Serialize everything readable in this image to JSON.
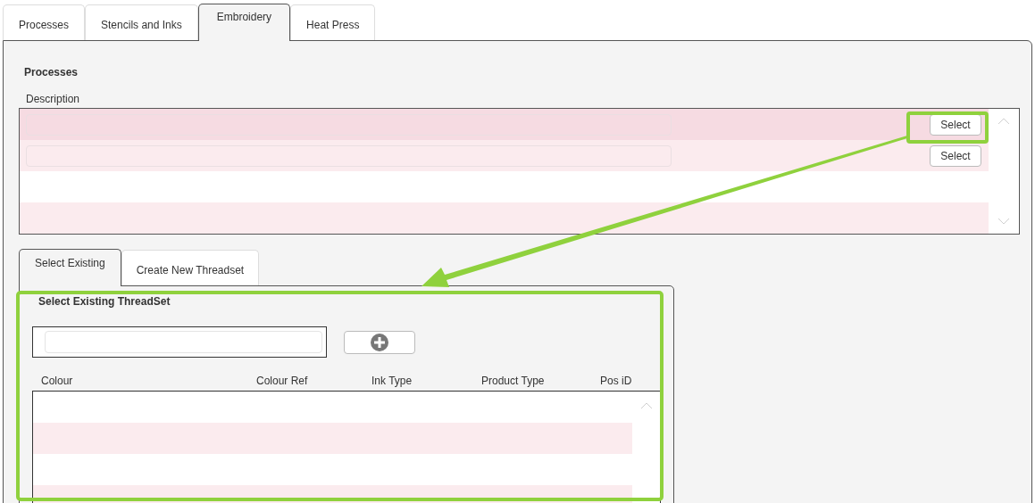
{
  "tabs": [
    {
      "label": "Processes",
      "selected": false
    },
    {
      "label": "Stencils and Inks",
      "selected": false
    },
    {
      "label": "Embroidery",
      "selected": true
    },
    {
      "label": "Heat Press",
      "selected": false
    }
  ],
  "processes": {
    "title": "Processes",
    "column": "Description",
    "rows": [
      {
        "selected": true,
        "button": "Select"
      },
      {
        "selected": false,
        "button": "Select"
      }
    ]
  },
  "sub_tabs": [
    {
      "label": "Select Existing",
      "selected": true
    },
    {
      "label": "Create New Threadset",
      "selected": false
    }
  ],
  "threadset": {
    "title": "Select Existing ThreadSet",
    "columns": [
      "Colour",
      "Colour Ref",
      "Ink Type",
      "Product Type",
      "Pos iD"
    ]
  }
}
